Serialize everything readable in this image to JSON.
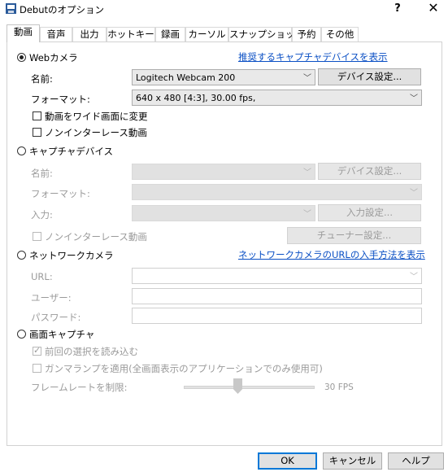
{
  "window": {
    "title": "Debutのオプション",
    "help_glyph": "?",
    "close_glyph": "✕"
  },
  "tabs": [
    "動画",
    "音声",
    "出力",
    "ホットキー",
    "録画",
    "カーソル",
    "スナップショット",
    "予約",
    "その他"
  ],
  "webcam": {
    "radio_label": "Webカメラ",
    "link": "推奨するキャプチャデバイスを表示",
    "name_label": "名前:",
    "name_value": "Logitech Webcam 200",
    "device_settings_button": "デバイス設定...",
    "format_label": "フォーマット:",
    "format_value": "640 x 480 [4:3], 30.00 fps,",
    "widescreen_label": "動画をワイド画面に変更",
    "noninterlace_label": "ノンインターレース動画"
  },
  "capture_device": {
    "radio_label": "キャプチャデバイス",
    "name_label": "名前:",
    "device_settings_button": "デバイス設定...",
    "format_label": "フォーマット:",
    "input_label": "入力:",
    "input_settings_button": "入力設定...",
    "noninterlace_label": "ノンインターレース動画",
    "tuner_settings_button": "チューナー設定..."
  },
  "network_camera": {
    "radio_label": "ネットワークカメラ",
    "link": "ネットワークカメラのURLの入手方法を表示",
    "url_label": "URL:",
    "user_label": "ユーザー:",
    "password_label": "パスワード:"
  },
  "screen_capture": {
    "radio_label": "画面キャプチャ",
    "load_previous_label": "前回の選択を読み込む",
    "gamma_label": "ガンマランプを適用(全画面表示のアプリケーションでのみ使用可)",
    "framerate_label": "フレームレートを制限:",
    "framerate_value": "30 FPS"
  },
  "buttons": {
    "ok": "OK",
    "cancel": "キャンセル",
    "help": "ヘルプ"
  },
  "colors": {
    "link": "#0a4fc4",
    "disabled_text": "#9a9a9a",
    "focus_border": "#0078d7"
  }
}
